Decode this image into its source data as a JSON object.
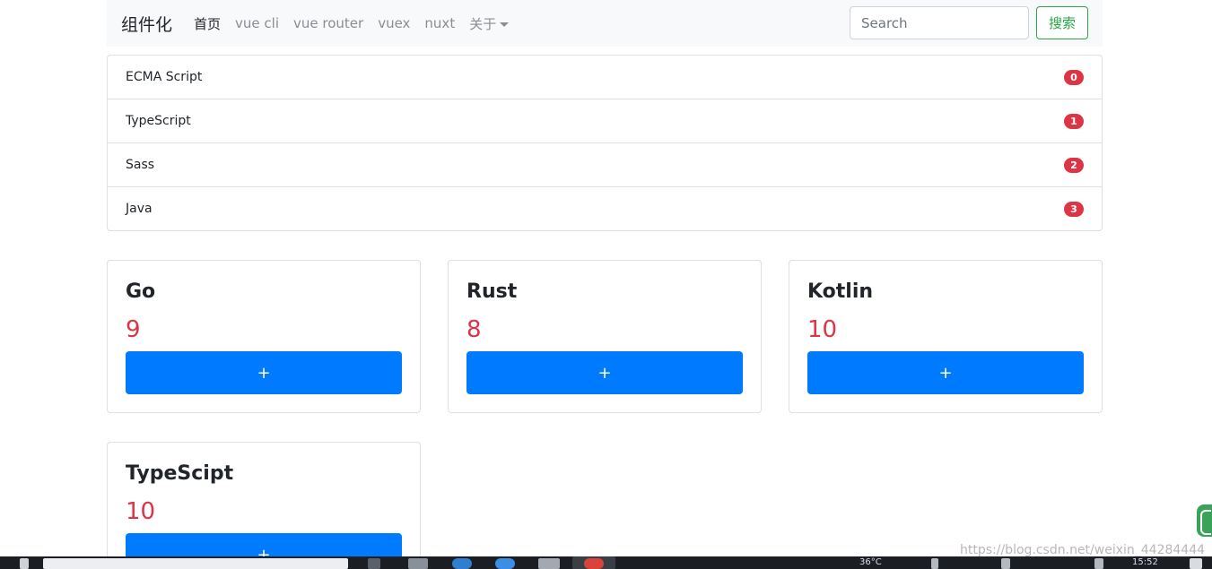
{
  "navbar": {
    "brand": "组件化",
    "links": [
      {
        "label": "首页",
        "active": true
      },
      {
        "label": "vue cli",
        "active": false
      },
      {
        "label": "vue router",
        "active": false
      },
      {
        "label": "vuex",
        "active": false
      },
      {
        "label": "nuxt",
        "active": false
      }
    ],
    "dropdown_label": "关于",
    "search_placeholder": "Search",
    "search_button": "搜索"
  },
  "list": {
    "items": [
      {
        "label": "ECMA Script",
        "badge": "0"
      },
      {
        "label": "TypeScript",
        "badge": "1"
      },
      {
        "label": "Sass",
        "badge": "2"
      },
      {
        "label": "Java",
        "badge": "3"
      }
    ]
  },
  "cards": [
    {
      "title": "Go",
      "count": "9",
      "button": "+"
    },
    {
      "title": "Rust",
      "count": "8",
      "button": "+"
    },
    {
      "title": "Kotlin",
      "count": "10",
      "button": "+"
    },
    {
      "title": "TypeScipt",
      "count": "10",
      "button": "+"
    }
  ],
  "taskbar": {
    "temperature": "36°C",
    "time": "15:52"
  },
  "watermark": "https://blog.csdn.net/weixin_44284444",
  "colors": {
    "primary": "#007bff",
    "danger": "#dc3545",
    "success": "#28a745",
    "navbar_bg": "#f8f9fa"
  }
}
